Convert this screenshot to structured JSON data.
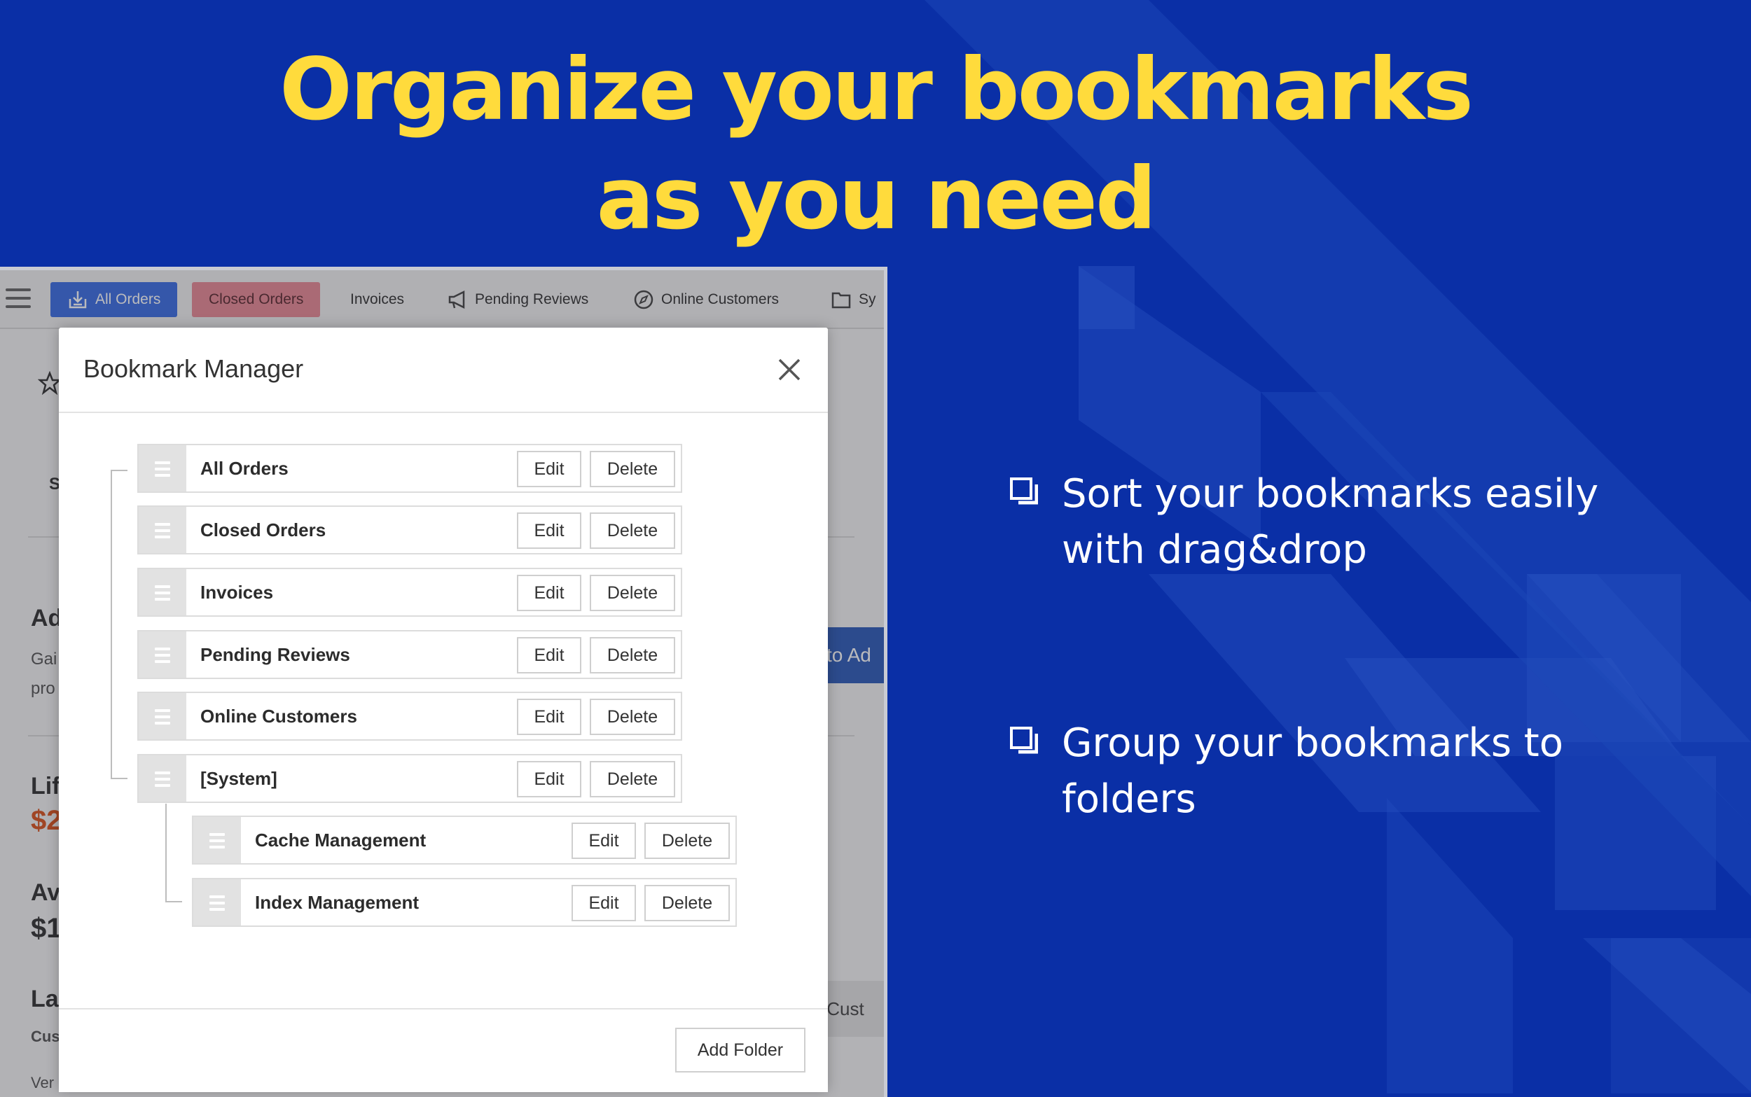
{
  "headline": {
    "line1": "Organize your bookmarks",
    "line2": "as you need"
  },
  "features": [
    {
      "line1": "Sort your bookmarks easily",
      "line2": "with drag&drop"
    },
    {
      "line1": "Group your bookmarks to",
      "line2": "folders"
    }
  ],
  "tabs": {
    "all_orders": "All Orders",
    "closed_orders": "Closed Orders",
    "invoices": "Invoices",
    "pending_reviews": "Pending Reviews",
    "online_customers": "Online Customers",
    "system": "Sy"
  },
  "background": {
    "s": "S",
    "ad": "Ad",
    "gai": "Gai",
    "pro": "pro",
    "lif": "Lif",
    "lif_value": "$2",
    "av": "Av",
    "av_value": "$1",
    "la": "La",
    "cus": "Cus",
    "ver": "Ver",
    "to_ad": "to Ad",
    "v_cust": "v Cust"
  },
  "modal": {
    "title": "Bookmark Manager",
    "add_folder": "Add Folder",
    "edit_label": "Edit",
    "delete_label": "Delete",
    "items": [
      {
        "label": "All Orders"
      },
      {
        "label": "Closed Orders"
      },
      {
        "label": "Invoices"
      },
      {
        "label": "Pending Reviews"
      },
      {
        "label": "Online Customers"
      },
      {
        "label": "[System]"
      },
      {
        "label": "Cache Management"
      },
      {
        "label": "Index Management"
      }
    ]
  },
  "colors": {
    "background": "#0a2fa6",
    "headline": "#ffdb3c",
    "active_tab": "#3b6ee3",
    "closed_tab": "#e88a96"
  }
}
